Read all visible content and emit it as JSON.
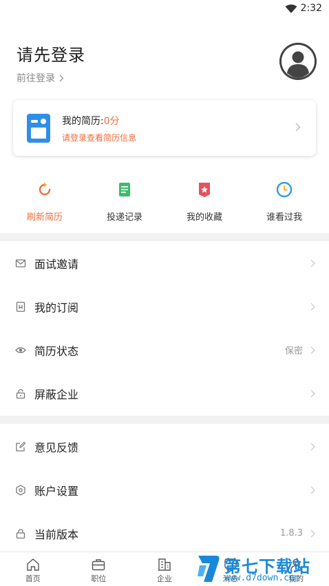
{
  "status_bar": {
    "time": "2:32"
  },
  "profile": {
    "title": "请先登录",
    "login_link": "前往登录"
  },
  "resume_card": {
    "label": "我的简历:",
    "score": "0分",
    "hint": "请登录查看简历信息"
  },
  "quick_actions": [
    {
      "label": "刷新简历",
      "icon": "refresh-icon",
      "color": "#f26b3a"
    },
    {
      "label": "投递记录",
      "icon": "document-icon",
      "color": "#3dbb6a"
    },
    {
      "label": "我的收藏",
      "icon": "bookmark-icon",
      "color": "#e8505b"
    },
    {
      "label": "谁看过我",
      "icon": "clock-icon",
      "color": "#2f9be5"
    }
  ],
  "menu": [
    {
      "label": "面试邀请",
      "icon": "envelope-icon",
      "value": ""
    },
    {
      "label": "我的订阅",
      "icon": "subscription-icon",
      "value": ""
    },
    {
      "label": "简历状态",
      "icon": "eye-icon",
      "value": "保密"
    },
    {
      "label": "屏蔽企业",
      "icon": "lock-icon",
      "value": ""
    },
    {
      "label": "意见反馈",
      "icon": "edit-icon",
      "value": ""
    },
    {
      "label": "账户设置",
      "icon": "settings-icon",
      "value": ""
    },
    {
      "label": "当前版本",
      "icon": "lock-icon",
      "value": "1.8.3"
    }
  ],
  "tabbar": [
    {
      "label": "首页",
      "icon": "home-icon"
    },
    {
      "label": "职位",
      "icon": "briefcase-icon"
    },
    {
      "label": "企业",
      "icon": "building-icon"
    },
    {
      "label": "消息",
      "icon": "message-icon"
    },
    {
      "label": "我的",
      "icon": "user-icon"
    }
  ],
  "watermark": {
    "title": "第七下载站",
    "url": "www.d7down.com"
  },
  "colors": {
    "accent": "#f26b3a",
    "brand_blue": "#1a88d8",
    "divider": "#f2f2f2"
  }
}
